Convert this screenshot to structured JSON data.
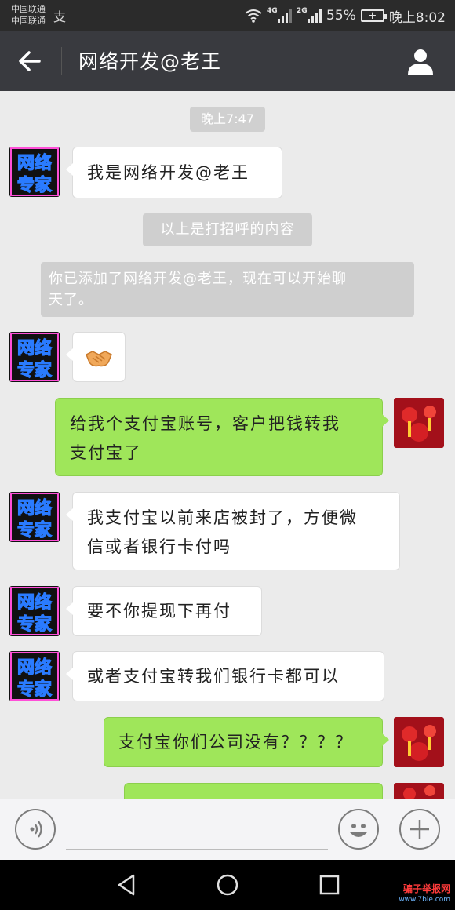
{
  "status_bar": {
    "carrier_1": "中国联通",
    "carrier_2": "中国联通",
    "alipay_glyph": "支",
    "network_1": "4G",
    "network_2": "2G",
    "battery_percent": "55%",
    "time": "晚上8:02"
  },
  "header": {
    "title": "网络开发@老王",
    "back_icon": "back-arrow-icon",
    "contact_icon": "person-icon"
  },
  "chat": {
    "timestamp": "晚上7:47",
    "system_greeting_label": "以上是打招呼的内容",
    "system_added_line1": "你已添加了网络开发@老王，现在可以开始聊",
    "system_added_line2": "天了。",
    "avatar_left_text": [
      "网络",
      "专家"
    ],
    "messages": [
      {
        "side": "in",
        "lines": [
          "我是网络开发@老王"
        ]
      },
      {
        "side": "in",
        "icon": "handshake-emoji-icon"
      },
      {
        "side": "out",
        "lines": [
          "给我个支付宝账号，客户把钱转我",
          "支付宝了"
        ]
      },
      {
        "side": "in",
        "lines": [
          "我支付宝以前来店被封了，方便微",
          "信或者银行卡付吗"
        ]
      },
      {
        "side": "in",
        "lines": [
          "要不你提现下再付"
        ]
      },
      {
        "side": "in",
        "lines": [
          "或者支付宝转我们银行卡都可以"
        ]
      },
      {
        "side": "out",
        "lines": [
          "支付宝你们公司没有？？？？"
        ]
      },
      {
        "side": "out",
        "lines": [
          ""
        ]
      }
    ]
  },
  "input_bar": {
    "voice_icon": "voice-icon",
    "emoji_icon": "smiley-icon",
    "plus_icon": "plus-icon"
  },
  "nav_bar": {
    "back_icon": "nav-back-icon",
    "home_icon": "nav-home-icon",
    "recent_icon": "nav-recent-icon"
  },
  "watermark": {
    "title": "骗子举报网",
    "url": "www.7bie.com"
  },
  "colors": {
    "header_bg": "#393a3f",
    "chat_bg": "#ebebeb",
    "outgoing_bubble": "#9fe65a",
    "incoming_bubble": "#ffffff",
    "system_bg": "#cfcfcf"
  }
}
